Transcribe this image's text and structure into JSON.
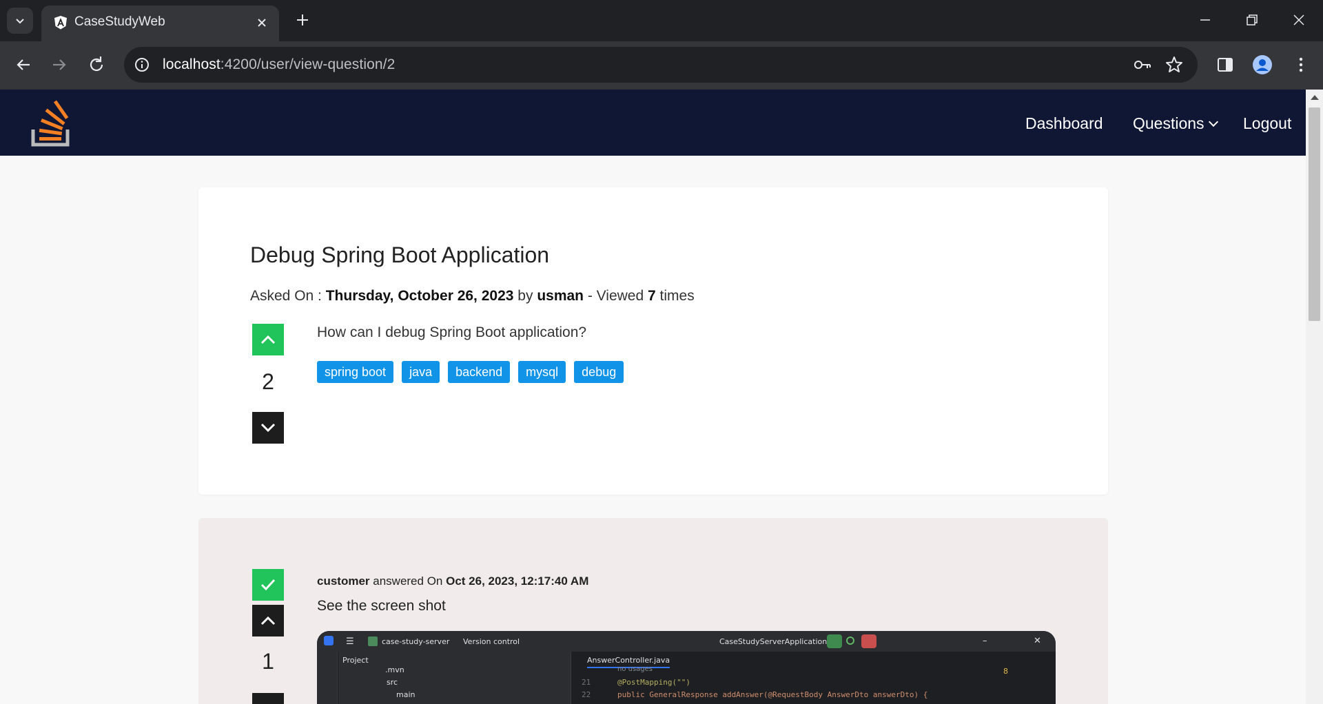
{
  "browser": {
    "tab_title": "CaseStudyWeb",
    "url_host": "localhost",
    "url_path": ":4200/user/view-question/2"
  },
  "nav": {
    "dashboard": "Dashboard",
    "questions": "Questions",
    "logout": "Logout"
  },
  "question": {
    "title": "Debug Spring Boot Application",
    "asked_on_label": "Asked On : ",
    "date": "Thursday, October 26, 2023",
    "by_label": " by ",
    "author": "usman",
    "viewed_label": " - Viewed ",
    "views": "7",
    "times_label": " times",
    "body": "How can I debug Spring Boot application?",
    "votes": "2",
    "tags": [
      "spring boot",
      "java",
      "backend",
      "mysql",
      "debug"
    ]
  },
  "answer": {
    "author": "customer",
    "answered_label": " answered On ",
    "date": "Oct 26, 2023, 12:17:40 AM",
    "body": "See the screen shot",
    "votes": "1",
    "accepted": true
  },
  "screenshot": {
    "project_name": "case-study-server",
    "vcs": "Version control",
    "run_config": "CaseStudyServerApplication",
    "project_label": "Project",
    "tree": [
      ".mvn",
      "src",
      "main"
    ],
    "file_tab": "AnswerController.java",
    "no_usages": "no usages",
    "line21": "21",
    "line22": "22",
    "code1": "@PostMapping(\"\")",
    "code2": "public GeneralResponse addAnswer(@RequestBody AnswerDto answerDto) {",
    "warnings": "8"
  },
  "colors": {
    "nav_bg": "#101735",
    "tag_bg": "#1193e8",
    "accept_green": "#21c45a",
    "answer_bg": "#f1ebeb"
  }
}
